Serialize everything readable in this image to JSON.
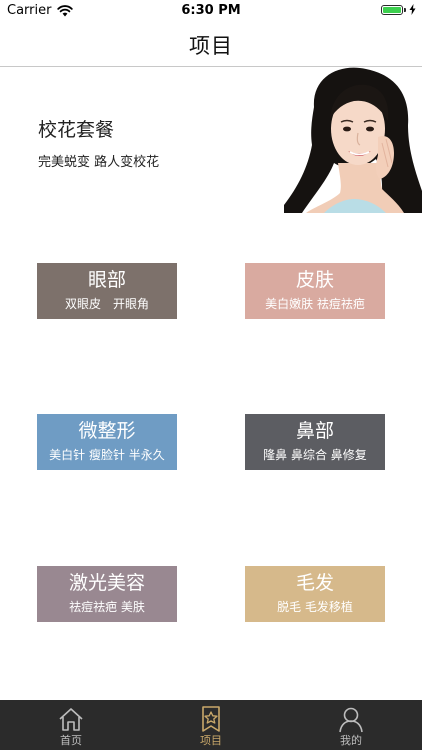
{
  "status_bar": {
    "carrier": "Carrier",
    "time": "6:30 PM",
    "battery_level": 1.0,
    "battery_color": "#3ccf4e",
    "charging_icon": "bolt-icon"
  },
  "nav": {
    "title": "项目"
  },
  "hero": {
    "title": "校花套餐",
    "subtitle": "完美蜕变 路人变校花",
    "image": "smiling-woman-portrait"
  },
  "categories": [
    {
      "title": "眼部",
      "subtitle": "双眼皮　开眼角",
      "color": "#7d716b"
    },
    {
      "title": "皮肤",
      "subtitle": "美白嫩肤 祛痘祛疤",
      "color": "#d9aaa0"
    },
    {
      "title": "微整形",
      "subtitle": "美白针 瘦脸针 半永久",
      "color": "#6f9cc4"
    },
    {
      "title": "鼻部",
      "subtitle": "隆鼻 鼻综合 鼻修复",
      "color": "#5c5d62"
    },
    {
      "title": "激光美容",
      "subtitle": "祛痘祛疤 美肤",
      "color": "#998891"
    },
    {
      "title": "毛发",
      "subtitle": "脱毛 毛发移植",
      "color": "#d6b98b"
    }
  ],
  "tabbar": {
    "background": "#2b2b2b",
    "active_color": "#c9a86a",
    "inactive_color": "#bdbdbd",
    "tabs": [
      {
        "label": "首页",
        "icon": "home-icon",
        "active": false
      },
      {
        "label": "项目",
        "icon": "starred-bookmark-icon",
        "active": true
      },
      {
        "label": "我的",
        "icon": "user-icon",
        "active": false
      }
    ]
  }
}
